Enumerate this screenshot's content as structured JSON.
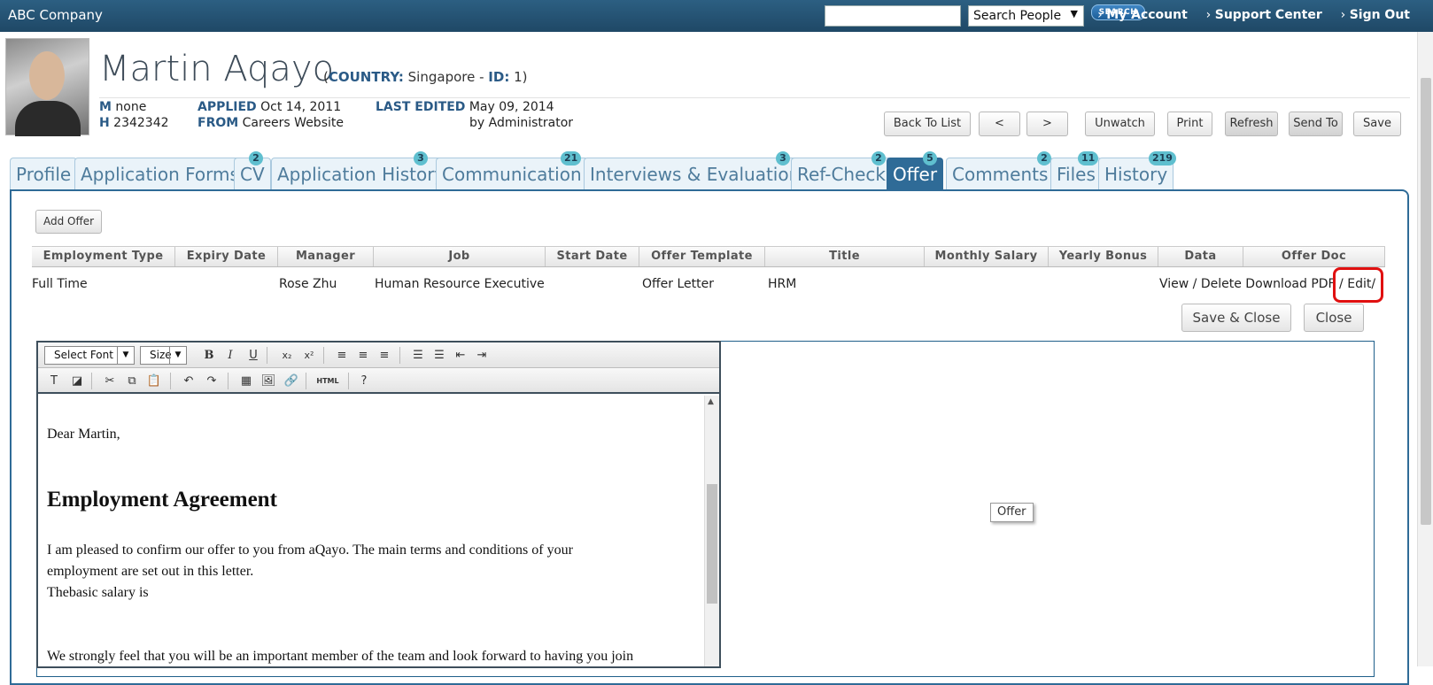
{
  "topbar": {
    "brand": "ABC Company",
    "search_select": "Search People",
    "search_button": "SEARCH",
    "links": [
      "My Account",
      "Support Center",
      "Sign Out"
    ]
  },
  "candidate": {
    "name": "Martin Aqayo",
    "country_label": "COUNTRY:",
    "country": "Singapore",
    "id_label": "ID:",
    "id": "1",
    "m_label": "M",
    "m_value": "none",
    "h_label": "H",
    "h_value": "2342342",
    "applied_label": "APPLIED",
    "applied_value": "Oct 14, 2011",
    "from_label": "FROM",
    "from_value": "Careers Website",
    "last_edited_label": "LAST EDITED",
    "last_edited_value": "May 09, 2014",
    "edited_by": "by Administrator"
  },
  "header_buttons": {
    "back": "Back To List",
    "prev": "<",
    "next": ">",
    "unwatch": "Unwatch",
    "print": "Print",
    "refresh": "Refresh",
    "send_to": "Send To",
    "save": "Save"
  },
  "tabs": [
    {
      "label": "Profile",
      "badge": ""
    },
    {
      "label": "Application Forms",
      "badge": ""
    },
    {
      "label": "CV",
      "badge": "2"
    },
    {
      "label": "Application History",
      "badge": "3"
    },
    {
      "label": "Communication",
      "badge": "21"
    },
    {
      "label": "Interviews & Evaluations",
      "badge": "3"
    },
    {
      "label": "Ref-Check",
      "badge": "2"
    },
    {
      "label": "Offer",
      "badge": "5"
    },
    {
      "label": "Comments",
      "badge": "2"
    },
    {
      "label": "Files",
      "badge": "11"
    },
    {
      "label": "History",
      "badge": "219"
    }
  ],
  "offer": {
    "add_button": "Add Offer",
    "columns": [
      "Employment Type",
      "Expiry Date",
      "Manager",
      "Job",
      "Start Date",
      "Offer Template",
      "Title",
      "Monthly Salary",
      "Yearly Bonus",
      "Data",
      "Offer Doc"
    ],
    "row": {
      "employment_type": "Full Time",
      "manager": "Rose Zhu",
      "job": "Human Resource Executive",
      "offer_template": "Offer Letter",
      "title": "HRM",
      "actions": "View / Delete Download PDF / Edit/"
    },
    "save_close": "Save & Close",
    "close": "Close"
  },
  "editor": {
    "font_select": "Select Font",
    "size_select": "Size",
    "html_label": "HTML",
    "salutation": "Dear Martin,",
    "heading": "Employment Agreement",
    "para1_line1": "I am pleased to confirm our offer to you from aQayo. The main terms and conditions of your",
    "para1_line2": "employment are set out in this letter.",
    "para1_line3": "Thebasic salary is",
    "para2": "We strongly feel that you will be an important member of the team and look forward to having you join"
  },
  "tooltip": "Offer"
}
